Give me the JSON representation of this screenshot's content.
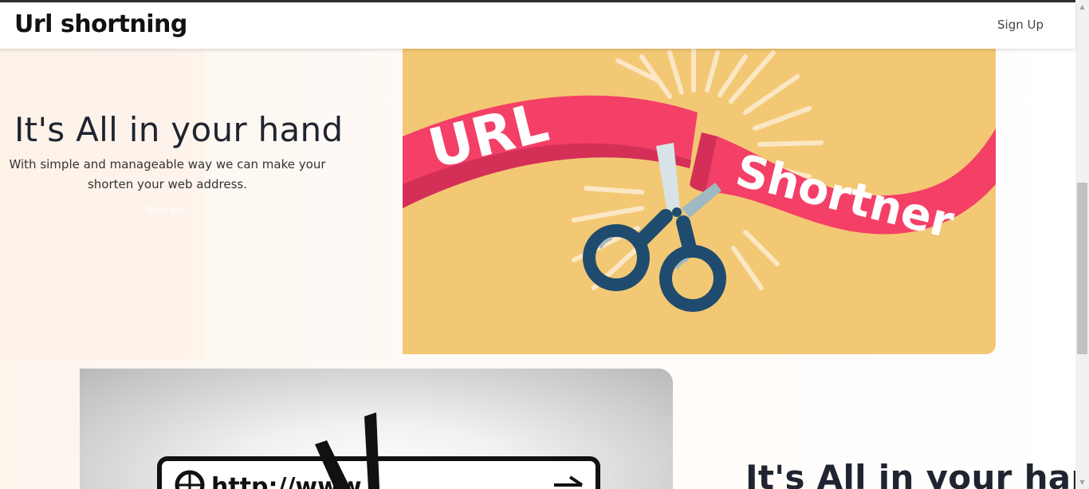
{
  "navbar": {
    "brand": "Url shortning",
    "signup_label": "Sign Up"
  },
  "hero": {
    "title": "It's All in your hand",
    "subtitle": "With simple and manageable way we can make your shorten your web address.",
    "button_label": "Find out",
    "image": {
      "word1": "URL",
      "word2": "Shortner"
    }
  },
  "second": {
    "title": "It's All in your hand",
    "image": {
      "url_text": "http://www"
    }
  },
  "colors": {
    "hero_bg": "#f3c874",
    "ribbon": "#f43f67",
    "scissors_dark": "#1f4c6e",
    "scissors_blade": "#d7e3e6"
  },
  "scrollbar": {
    "up_icon": "scroll-up-arrow-icon",
    "down_icon": "scroll-down-arrow-icon"
  }
}
